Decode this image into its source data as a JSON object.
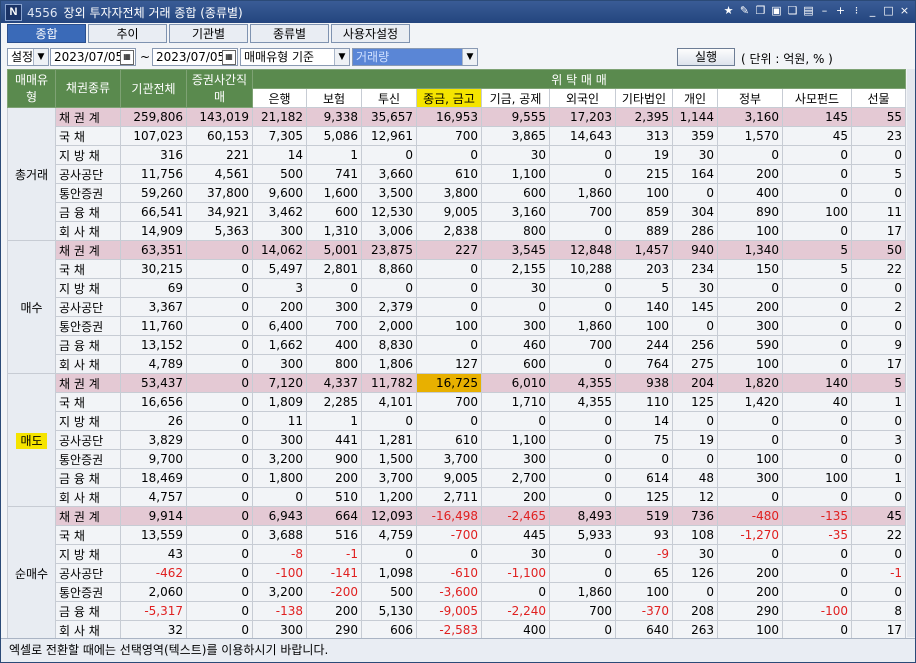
{
  "window": {
    "code": "4556",
    "title": "장외 투자자전체 거래 종합 (종류별)",
    "icons": [
      "star-icon",
      "pin-icon",
      "copy-icon",
      "layout-icon",
      "restore-icon",
      "lock-icon",
      "minimize-icon",
      "add-icon",
      "scroll-icon",
      "minimize-window-icon",
      "maximize-window-icon",
      "close-icon"
    ]
  },
  "tabs": [
    {
      "label": "종합",
      "active": true
    },
    {
      "label": "추이",
      "active": false
    },
    {
      "label": "기관별",
      "active": false
    },
    {
      "label": "종류별",
      "active": false
    },
    {
      "label": "사용자설정",
      "active": false
    }
  ],
  "controls": {
    "mode": "설정",
    "date_from": "2023/07/05",
    "tilde": "~",
    "date_to": "2023/07/05",
    "basis": "매매유형 기준",
    "filter": "거래량",
    "run_label": "실행",
    "unit_label": "( 단위 : 억원, % )"
  },
  "table": {
    "header_top": [
      "매매유형",
      "채권종류",
      "기관전체",
      "증권사간직매",
      "위 탁 매 매"
    ],
    "sub_columns": [
      "은행",
      "보험",
      "투신",
      "종금, 금고",
      "기금, 공제",
      "외국인",
      "기타법인",
      "개인",
      "정부",
      "사모펀드",
      "선물"
    ],
    "groups": [
      {
        "label": "총거래",
        "selected": false,
        "rows": [
          {
            "type": "채 권 계",
            "total": true,
            "values": [
              "259,806",
              "143,019",
              "21,182",
              "9,338",
              "35,657",
              "16,953",
              "9,555",
              "17,203",
              "2,395",
              "1,144",
              "3,160",
              "145",
              "55"
            ]
          },
          {
            "type": "국      채",
            "values": [
              "107,023",
              "60,153",
              "7,305",
              "5,086",
              "12,961",
              "700",
              "3,865",
              "14,643",
              "313",
              "359",
              "1,570",
              "45",
              "23"
            ]
          },
          {
            "type": "지 방 채",
            "values": [
              "316",
              "221",
              "14",
              "1",
              "0",
              "0",
              "30",
              "0",
              "19",
              "30",
              "0",
              "0",
              "0"
            ]
          },
          {
            "type": "공사공단",
            "values": [
              "11,756",
              "4,561",
              "500",
              "741",
              "3,660",
              "610",
              "1,100",
              "0",
              "215",
              "164",
              "200",
              "0",
              "5"
            ]
          },
          {
            "type": "통안증권",
            "values": [
              "59,260",
              "37,800",
              "9,600",
              "1,600",
              "3,500",
              "3,800",
              "600",
              "1,860",
              "100",
              "0",
              "400",
              "0",
              "0"
            ]
          },
          {
            "type": "금 융 채",
            "values": [
              "66,541",
              "34,921",
              "3,462",
              "600",
              "12,530",
              "9,005",
              "3,160",
              "700",
              "859",
              "304",
              "890",
              "100",
              "11"
            ]
          },
          {
            "type": "회 사 채",
            "values": [
              "14,909",
              "5,363",
              "300",
              "1,310",
              "3,006",
              "2,838",
              "800",
              "0",
              "889",
              "286",
              "100",
              "0",
              "17"
            ]
          }
        ]
      },
      {
        "label": "매수",
        "selected": false,
        "rows": [
          {
            "type": "채 권 계",
            "total": true,
            "values": [
              "63,351",
              "0",
              "14,062",
              "5,001",
              "23,875",
              "227",
              "3,545",
              "12,848",
              "1,457",
              "940",
              "1,340",
              "5",
              "50"
            ]
          },
          {
            "type": "국      채",
            "values": [
              "30,215",
              "0",
              "5,497",
              "2,801",
              "8,860",
              "0",
              "2,155",
              "10,288",
              "203",
              "234",
              "150",
              "5",
              "22"
            ]
          },
          {
            "type": "지 방 채",
            "values": [
              "69",
              "0",
              "3",
              "0",
              "0",
              "0",
              "30",
              "0",
              "5",
              "30",
              "0",
              "0",
              "0"
            ]
          },
          {
            "type": "공사공단",
            "values": [
              "3,367",
              "0",
              "200",
              "300",
              "2,379",
              "0",
              "0",
              "0",
              "140",
              "145",
              "200",
              "0",
              "2"
            ]
          },
          {
            "type": "통안증권",
            "values": [
              "11,760",
              "0",
              "6,400",
              "700",
              "2,000",
              "100",
              "300",
              "1,860",
              "100",
              "0",
              "300",
              "0",
              "0"
            ]
          },
          {
            "type": "금 융 채",
            "values": [
              "13,152",
              "0",
              "1,662",
              "400",
              "8,830",
              "0",
              "460",
              "700",
              "244",
              "256",
              "590",
              "0",
              "9"
            ]
          },
          {
            "type": "회 사 채",
            "values": [
              "4,789",
              "0",
              "300",
              "800",
              "1,806",
              "127",
              "600",
              "0",
              "764",
              "275",
              "100",
              "0",
              "17"
            ]
          }
        ]
      },
      {
        "label": "매도",
        "selected": true,
        "rows": [
          {
            "type": "채 권 계",
            "total": true,
            "values": [
              "53,437",
              "0",
              "7,120",
              "4,337",
              "11,782",
              "16,725",
              "6,010",
              "4,355",
              "938",
              "204",
              "1,820",
              "140",
              "5"
            ]
          },
          {
            "type": "국      채",
            "values": [
              "16,656",
              "0",
              "1,809",
              "2,285",
              "4,101",
              "700",
              "1,710",
              "4,355",
              "110",
              "125",
              "1,420",
              "40",
              "1"
            ]
          },
          {
            "type": "지 방 채",
            "values": [
              "26",
              "0",
              "11",
              "1",
              "0",
              "0",
              "0",
              "0",
              "14",
              "0",
              "0",
              "0",
              "0"
            ]
          },
          {
            "type": "공사공단",
            "values": [
              "3,829",
              "0",
              "300",
              "441",
              "1,281",
              "610",
              "1,100",
              "0",
              "75",
              "19",
              "0",
              "0",
              "3"
            ]
          },
          {
            "type": "통안증권",
            "values": [
              "9,700",
              "0",
              "3,200",
              "900",
              "1,500",
              "3,700",
              "300",
              "0",
              "0",
              "0",
              "100",
              "0",
              "0"
            ]
          },
          {
            "type": "금 융 채",
            "values": [
              "18,469",
              "0",
              "1,800",
              "200",
              "3,700",
              "9,005",
              "2,700",
              "0",
              "614",
              "48",
              "300",
              "100",
              "1"
            ]
          },
          {
            "type": "회 사 채",
            "values": [
              "4,757",
              "0",
              "0",
              "510",
              "1,200",
              "2,711",
              "200",
              "0",
              "125",
              "12",
              "0",
              "0",
              "0"
            ]
          }
        ]
      },
      {
        "label": "순매수",
        "selected": false,
        "rows": [
          {
            "type": "채 권 계",
            "total": true,
            "values": [
              "9,914",
              "0",
              "6,943",
              "664",
              "12,093",
              "-16,498",
              "-2,465",
              "8,493",
              "519",
              "736",
              "-480",
              "-135",
              "45"
            ]
          },
          {
            "type": "국      채",
            "values": [
              "13,559",
              "0",
              "3,688",
              "516",
              "4,759",
              "-700",
              "445",
              "5,933",
              "93",
              "108",
              "-1,270",
              "-35",
              "22"
            ]
          },
          {
            "type": "지 방 채",
            "values": [
              "43",
              "0",
              "-8",
              "-1",
              "0",
              "0",
              "30",
              "0",
              "-9",
              "30",
              "0",
              "0",
              "0"
            ]
          },
          {
            "type": "공사공단",
            "values": [
              "-462",
              "0",
              "-100",
              "-141",
              "1,098",
              "-610",
              "-1,100",
              "0",
              "65",
              "126",
              "200",
              "0",
              "-1"
            ]
          },
          {
            "type": "통안증권",
            "values": [
              "2,060",
              "0",
              "3,200",
              "-200",
              "500",
              "-3,600",
              "0",
              "1,860",
              "100",
              "0",
              "200",
              "0",
              "0"
            ]
          },
          {
            "type": "금 융 채",
            "values": [
              "-5,317",
              "0",
              "-138",
              "200",
              "5,130",
              "-9,005",
              "-2,240",
              "700",
              "-370",
              "208",
              "290",
              "-100",
              "8"
            ]
          },
          {
            "type": "회 사 채",
            "values": [
              "32",
              "0",
              "300",
              "290",
              "606",
              "-2,583",
              "400",
              "0",
              "640",
              "263",
              "100",
              "0",
              "17"
            ]
          }
        ]
      }
    ]
  },
  "status_text": "엑셀로 전환할 때에는 선택영역(텍스트)를 이용하시기 바랍니다."
}
